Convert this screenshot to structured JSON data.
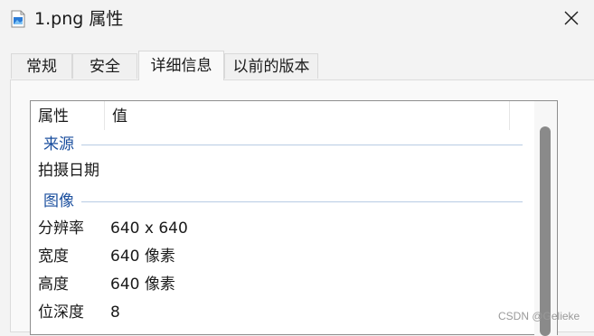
{
  "window": {
    "title": "1.png 属性",
    "icons": {
      "file": "image-file-icon",
      "close": "close-icon"
    }
  },
  "tabs": [
    {
      "label": "常规",
      "active": false
    },
    {
      "label": "安全",
      "active": false
    },
    {
      "label": "详细信息",
      "active": true
    },
    {
      "label": "以前的版本",
      "active": false
    }
  ],
  "details": {
    "columns": {
      "name": "属性",
      "value": "值"
    },
    "groups": [
      {
        "label": "来源",
        "rows": [
          {
            "name": "拍摄日期",
            "value": ""
          }
        ]
      },
      {
        "label": "图像",
        "rows": [
          {
            "name": "分辨率",
            "value": "640 x 640"
          },
          {
            "name": "宽度",
            "value": "640 像素"
          },
          {
            "name": "高度",
            "value": "640 像素"
          },
          {
            "name": "位深度",
            "value": "8"
          }
        ]
      }
    ]
  },
  "watermark": "CSDN @Gelieke",
  "colors": {
    "group_label": "#1b4f9e",
    "window_bg": "#f3f3f3",
    "list_bg": "#ffffff"
  }
}
